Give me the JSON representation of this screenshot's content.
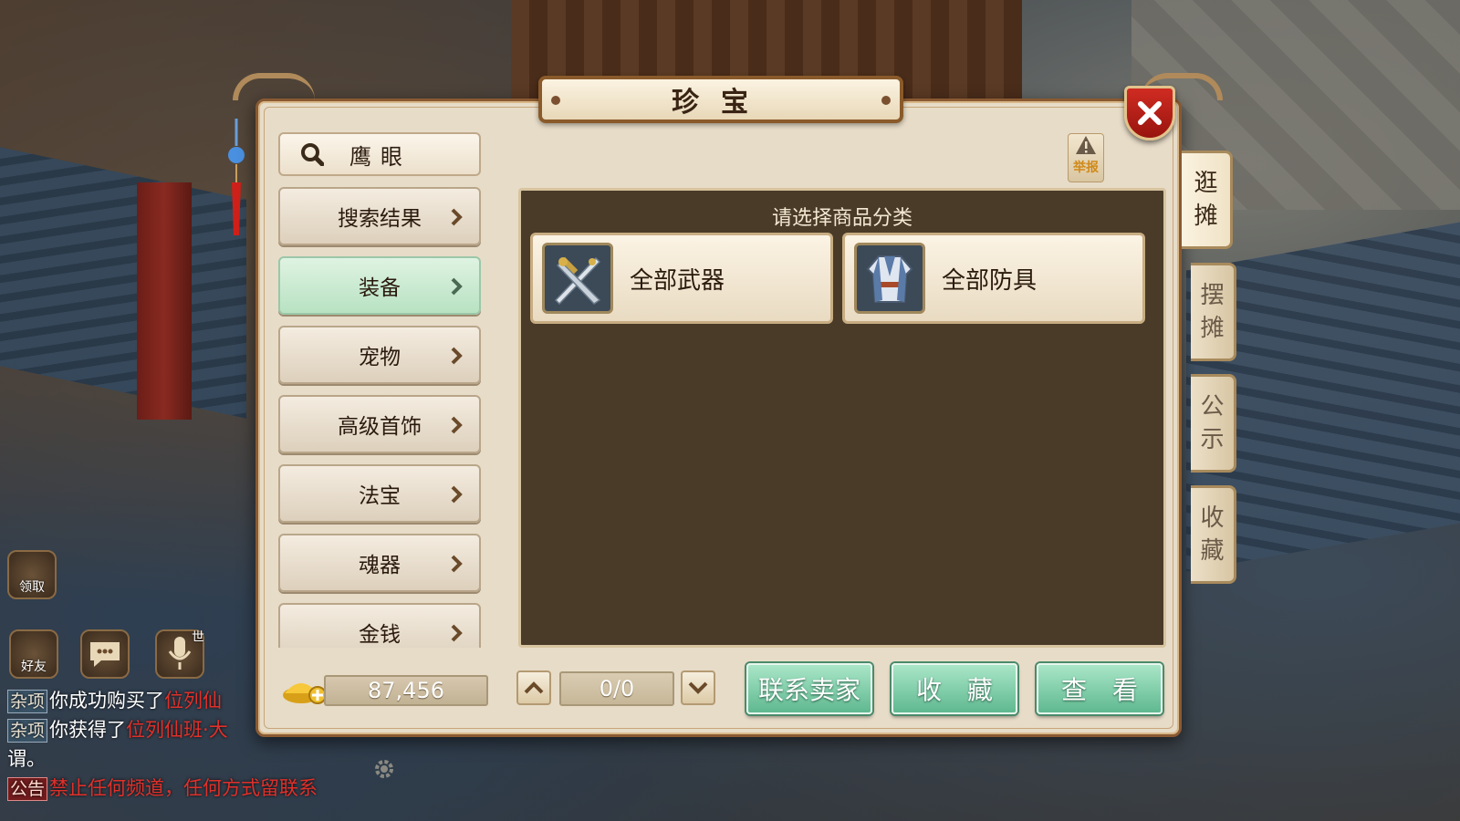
{
  "window": {
    "title": "珍宝"
  },
  "report": {
    "label": "举报"
  },
  "sidebar": {
    "search_label": "鹰眼",
    "items": [
      {
        "label": "搜索结果",
        "active": false
      },
      {
        "label": "装备",
        "active": true
      },
      {
        "label": "宠物",
        "active": false
      },
      {
        "label": "高级首饰",
        "active": false
      },
      {
        "label": "法宝",
        "active": false
      },
      {
        "label": "魂器",
        "active": false
      },
      {
        "label": "金钱",
        "active": false
      }
    ]
  },
  "content": {
    "prompt": "请选择商品分类",
    "categories": [
      {
        "label": "全部武器",
        "icon": "crossed-swords-icon"
      },
      {
        "label": "全部防具",
        "icon": "armor-robe-icon"
      }
    ]
  },
  "side_tabs": [
    {
      "label_1": "逛",
      "label_2": "摊",
      "active": true
    },
    {
      "label_1": "摆",
      "label_2": "摊",
      "active": false
    },
    {
      "label_1": "公",
      "label_2": "示",
      "active": false
    },
    {
      "label_1": "收",
      "label_2": "藏",
      "active": false
    }
  ],
  "footer": {
    "gold_amount": "87,456",
    "page_indicator": "0/0",
    "contact_seller": "联系卖家",
    "favorite": "收　藏",
    "view": "查　看"
  },
  "hud": {
    "claim_label": "领取",
    "friends_label": "好友",
    "world_label": "世"
  },
  "chat": [
    {
      "tag": "杂项",
      "text": "你成功购买了",
      "link": "位列仙"
    },
    {
      "tag": "杂项",
      "text": "你获得了",
      "link": "位列仙班·大"
    },
    {
      "tag": "",
      "text": "谓。",
      "link": ""
    },
    {
      "tag": "公告",
      "text": "",
      "link": "禁止任何频道，任何方式留联系"
    }
  ],
  "colors": {
    "frame": "#8a5a32",
    "panel": "#e7dcc8",
    "content_bg": "#4a3a28",
    "action_green": "#5fb890",
    "active_green": "#b8e2c2",
    "close_red": "#c8241c"
  }
}
